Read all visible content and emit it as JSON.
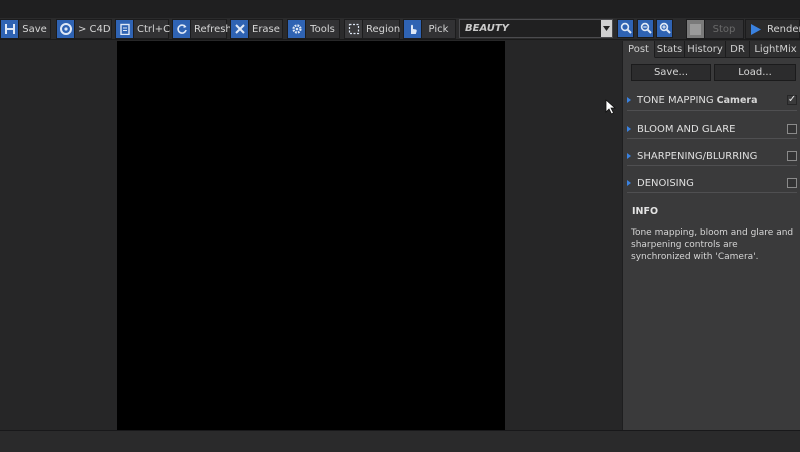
{
  "toolbar": {
    "save": "Save",
    "to_c4d": "> C4D",
    "copy": "Ctrl+C",
    "refresh": "Refresh",
    "erase": "Erase",
    "tools": "Tools",
    "region": "Region",
    "pick": "Pick",
    "pass_select": "BEAUTY",
    "stop": "Stop",
    "render": "Render"
  },
  "panel": {
    "tabs": [
      "Post",
      "Stats",
      "History",
      "DR",
      "LightMix"
    ],
    "active_tab": "Post",
    "save_button": "Save...",
    "load_button": "Load...",
    "sections": [
      {
        "title": "TONE MAPPING",
        "subtitle": "Camera",
        "checked": true
      },
      {
        "title": "BLOOM AND GLARE",
        "checked": false
      },
      {
        "title": "SHARPENING/BLURRING",
        "checked": false
      },
      {
        "title": "DENOISING",
        "checked": false
      }
    ],
    "info_title": "INFO",
    "info_text": "Tone mapping, bloom and glare and sharpening controls are synchronized with 'Camera'."
  },
  "colors": {
    "accent": "#2f63b3",
    "background": "#262627",
    "panel": "#3a3a3b",
    "canvas": "#000000"
  }
}
